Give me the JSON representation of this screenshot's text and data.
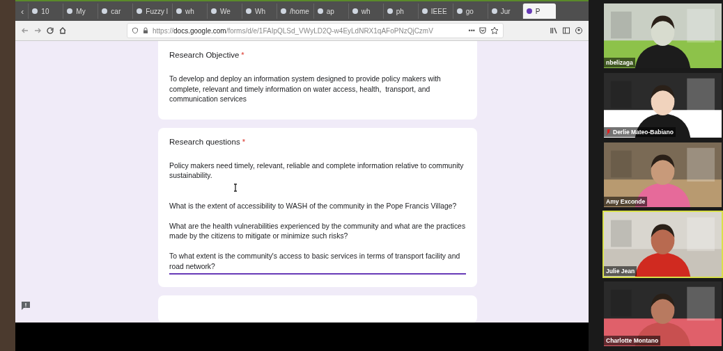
{
  "browser": {
    "scroll_arrow": "‹",
    "tabs": [
      {
        "label": "10",
        "selected": false
      },
      {
        "label": "My",
        "selected": false
      },
      {
        "label": "car",
        "selected": false
      },
      {
        "label": "Fuzzy l",
        "selected": false
      },
      {
        "label": "wh",
        "selected": false
      },
      {
        "label": "We",
        "selected": false
      },
      {
        "label": "Wh",
        "selected": false
      },
      {
        "label": "/home",
        "selected": false
      },
      {
        "label": "ap",
        "selected": false
      },
      {
        "label": "wh",
        "selected": false
      },
      {
        "label": "ph",
        "selected": false
      },
      {
        "label": "IEEE",
        "selected": false
      },
      {
        "label": "go",
        "selected": false
      },
      {
        "label": "Jur",
        "selected": false
      },
      {
        "label": "P",
        "selected": true
      }
    ],
    "url_host": "docs.google.com",
    "url_scheme": "https://",
    "url_path": "/forms/d/e/1FAIpQLSd_VWyLD2Q-w4EyLdNRX1qAFoPNzQjCzmV",
    "more": "•••"
  },
  "form": {
    "cards": [
      {
        "title": "Research Objective",
        "required": true,
        "required_mark": "*",
        "value": "To develop and deploy an information system designed to provide policy makers with complete, relevant and timely information on water access, health,  transport, and communication services",
        "focused": false
      },
      {
        "title": "Research questions",
        "required": true,
        "required_mark": "*",
        "value": "Policy makers need timely, relevant, reliable and complete information relative to community sustainability.\n\n\nWhat is the extent of accessibility to WASH of the community in the Pope Francis Village?\n\nWhat are the health vulnerabilities experienced by the community and what are the practices made by the citizens to mitigate or minimize such risks?\n\nTo what extent is the community's access to basic services in terms of transport facility and road network?",
        "focused": true
      }
    ]
  },
  "participants": [
    {
      "name": "nbelizaga",
      "muted": false,
      "speaking": false
    },
    {
      "name": "Derlie Mateo-Babiano",
      "muted": true,
      "speaking": false
    },
    {
      "name": "Amy Exconde",
      "muted": false,
      "speaking": false
    },
    {
      "name": "Julie Jean",
      "muted": false,
      "speaking": true
    },
    {
      "name": "Charlotte Montano",
      "muted": false,
      "speaking": false
    }
  ]
}
